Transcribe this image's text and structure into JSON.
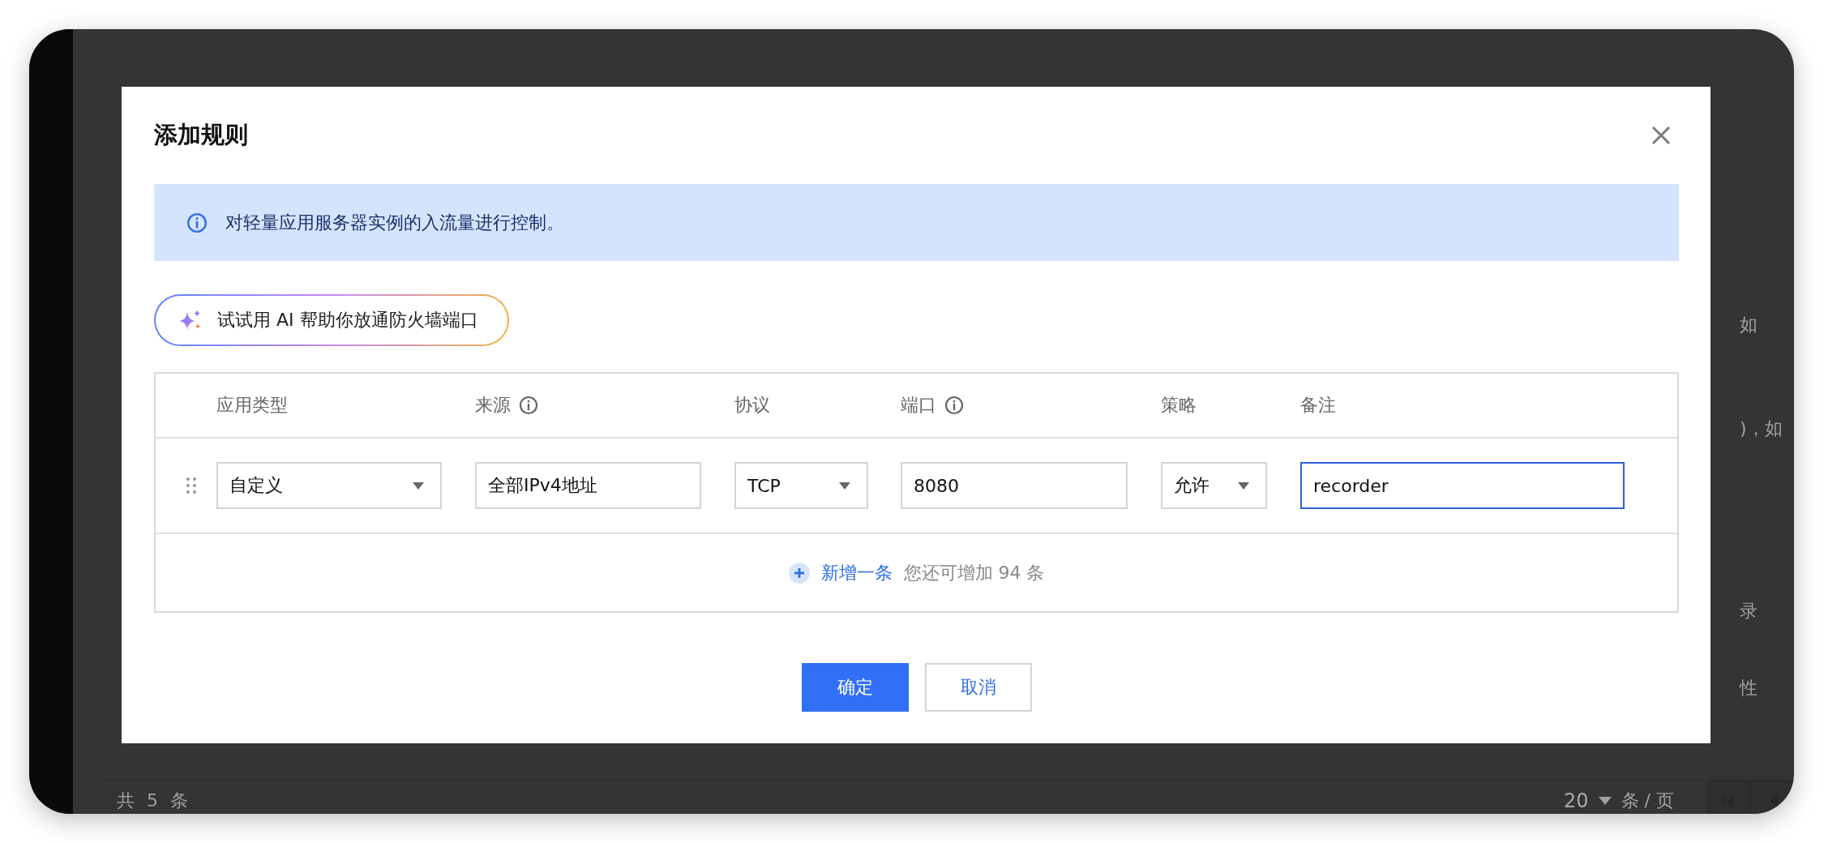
{
  "background_page": {
    "right_cells": [
      "如",
      ")，如",
      "录",
      "性"
    ],
    "footer": {
      "total": "共 5 条",
      "page_size": "20",
      "page_size_unit": "条 / 页"
    }
  },
  "dialog": {
    "title": "添加规则",
    "notice": "对轻量应用服务器实例的入流量进行控制。",
    "ai_button": "试试用 AI 帮助你放通防火墙端口",
    "table": {
      "columns": [
        {
          "label": "应用类型",
          "info": false
        },
        {
          "label": "来源",
          "info": true
        },
        {
          "label": "协议",
          "info": false
        },
        {
          "label": "端口",
          "info": true
        },
        {
          "label": "策略",
          "info": false
        },
        {
          "label": "备注",
          "info": false
        }
      ],
      "rows": [
        {
          "cells": [
            {
              "kind": "select",
              "value": "自定义"
            },
            {
              "kind": "input",
              "value": "全部IPv4地址"
            },
            {
              "kind": "select",
              "value": "TCP"
            },
            {
              "kind": "input",
              "value": "8080"
            },
            {
              "kind": "select",
              "value": "允许"
            },
            {
              "kind": "input",
              "value": "recorder",
              "focused": true
            }
          ]
        }
      ]
    },
    "add_row": {
      "label": "新增一条",
      "remaining": "您还可增加 94 条"
    },
    "buttons": [
      {
        "label": "确定",
        "kind": "primary"
      },
      {
        "label": "取消",
        "kind": "secondary"
      }
    ]
  }
}
